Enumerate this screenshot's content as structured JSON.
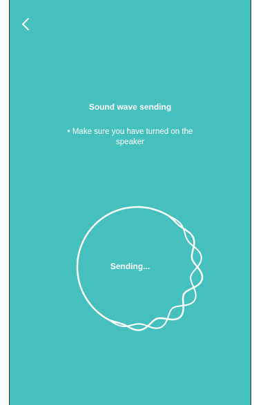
{
  "header": {
    "back_icon": "chevron-left-icon"
  },
  "content": {
    "title": "Sound wave sending",
    "hint": "• Make sure you have turned on the speaker"
  },
  "status": {
    "label": "Sending..."
  },
  "theme": {
    "background": "#46bfbf",
    "foreground": "#ffffff"
  }
}
